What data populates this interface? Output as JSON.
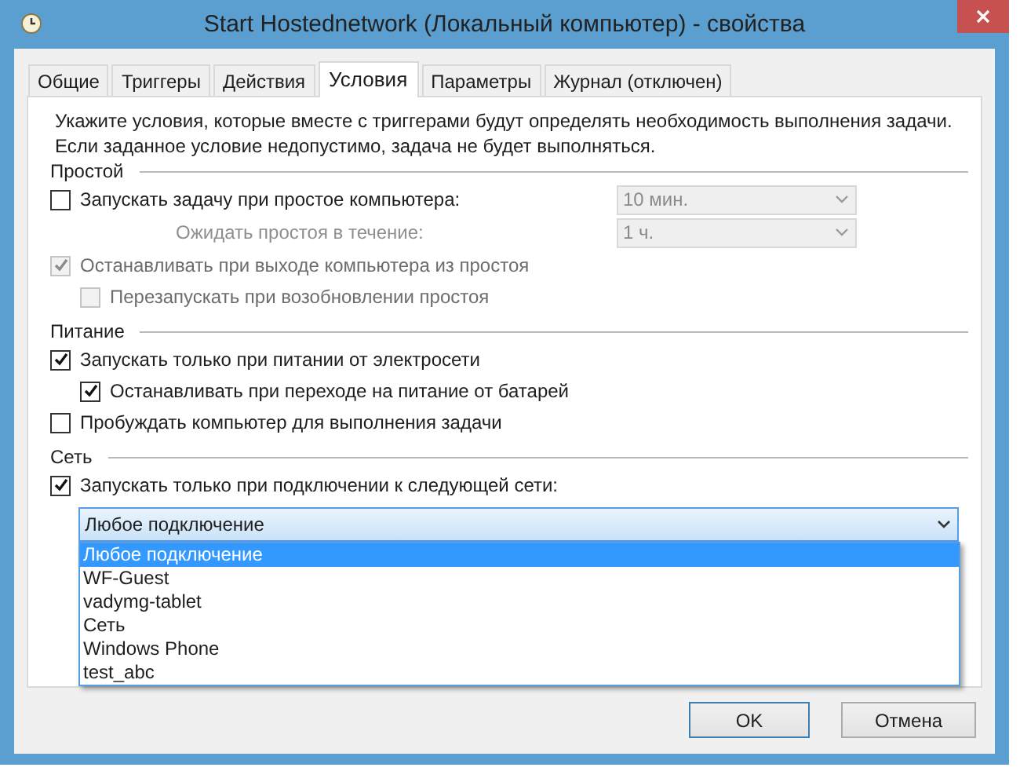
{
  "window": {
    "title": "Start Hostednetwork (Локальный компьютер) - свойства"
  },
  "tabs": [
    {
      "label": "Общие",
      "selected": false
    },
    {
      "label": "Триггеры",
      "selected": false
    },
    {
      "label": "Действия",
      "selected": false
    },
    {
      "label": "Условия",
      "selected": true
    },
    {
      "label": "Параметры",
      "selected": false
    },
    {
      "label": "Журнал (отключен)",
      "selected": false
    }
  ],
  "description": [
    "Укажите условия, которые вместе с триггерами будут определять необходимость выполнения задачи.",
    "Если заданное условие недопустимо, задача не будет выполняться."
  ],
  "sections": [
    {
      "title": "Простой",
      "items": [
        {
          "kind": "checkbox",
          "label": "Запускать задачу при простое компьютера:",
          "checked": false,
          "disabled": false,
          "combo": {
            "value": "10 мин.",
            "disabled": true
          }
        },
        {
          "kind": "field",
          "label": "Ожидать простоя в течение:",
          "disabled": true,
          "combo": {
            "value": "1 ч.",
            "disabled": true
          }
        },
        {
          "kind": "checkbox",
          "label": "Останавливать при выходе компьютера из простоя",
          "checked": true,
          "disabled": true,
          "children": [
            {
              "kind": "checkbox",
              "label": "Перезапускать при возобновлении простоя",
              "checked": false,
              "disabled": true
            }
          ]
        }
      ]
    },
    {
      "title": "Питание",
      "items": [
        {
          "kind": "checkbox",
          "label": "Запускать только при питании от электросети",
          "checked": true,
          "disabled": false,
          "children": [
            {
              "kind": "checkbox",
              "label": "Останавливать при переходе на питание от батарей",
              "checked": true,
              "disabled": false
            }
          ]
        },
        {
          "kind": "checkbox",
          "label": "Пробуждать компьютер для выполнения задачи",
          "checked": false,
          "disabled": false
        }
      ]
    },
    {
      "title": "Сеть",
      "items": [
        {
          "kind": "checkbox",
          "label": "Запускать только при подключении к следующей сети:",
          "checked": true,
          "disabled": false
        },
        {
          "kind": "dropdown",
          "value": "Любое подключение",
          "expanded": true,
          "options": [
            {
              "label": "Любое подключение",
              "selected": true
            },
            {
              "label": "WF-Guest",
              "selected": false
            },
            {
              "label": "vadymg-tablet",
              "selected": false
            },
            {
              "label": "Сеть",
              "selected": false
            },
            {
              "label": "Windows Phone",
              "selected": false
            },
            {
              "label": "test_abc",
              "selected": false
            }
          ]
        }
      ]
    }
  ],
  "buttons": [
    {
      "label": "OK",
      "default": true
    },
    {
      "label": "Отмена",
      "default": false
    }
  ]
}
